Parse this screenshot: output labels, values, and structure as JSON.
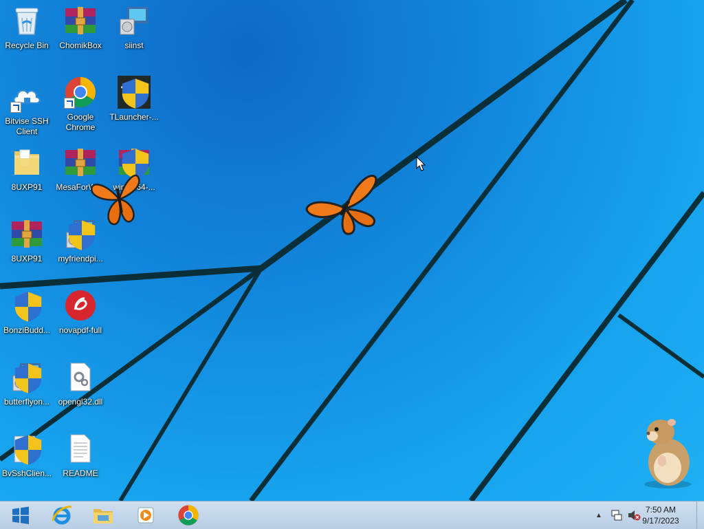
{
  "desktop": {
    "icons": [
      {
        "id": "recycle-bin",
        "label": "Recycle Bin"
      },
      {
        "id": "chomikbox",
        "label": "ChomikBox"
      },
      {
        "id": "siinst",
        "label": "siinst"
      },
      {
        "id": "bitvise",
        "label": "Bitvise SSH Client"
      },
      {
        "id": "chrome",
        "label": "Google Chrome"
      },
      {
        "id": "tlauncher",
        "label": "TLauncher-..."
      },
      {
        "id": "folder-8uxp91",
        "label": "8UXP91"
      },
      {
        "id": "mesaforwin",
        "label": "MesaForWi..."
      },
      {
        "id": "winrar64",
        "label": "win...x64-..."
      },
      {
        "id": "rar-8uxp91",
        "label": "8UXP91"
      },
      {
        "id": "myfriendpi",
        "label": "myfriendpi..."
      },
      {
        "id": "bonzibuddy",
        "label": "BonziBudd..."
      },
      {
        "id": "novapdf",
        "label": "novapdf-full"
      },
      {
        "id": "butterflyon",
        "label": "butterflyon..."
      },
      {
        "id": "opengl32",
        "label": "opengl32.dll"
      },
      {
        "id": "bvsshclient",
        "label": "BvSshClien..."
      },
      {
        "id": "readme",
        "label": "README"
      }
    ]
  },
  "taskbar": {
    "buttons": [
      {
        "id": "start",
        "icon": "windows-logo-icon"
      },
      {
        "id": "ie",
        "icon": "internet-explorer-icon"
      },
      {
        "id": "explorer",
        "icon": "file-explorer-icon"
      },
      {
        "id": "media",
        "icon": "media-player-icon"
      },
      {
        "id": "chrome",
        "icon": "chrome-icon"
      }
    ],
    "tray": {
      "chevron": "▲",
      "time": "7:50 AM",
      "date": "9/17/2023"
    }
  },
  "colors": {
    "accent": "#1287dc",
    "taskbar": "#c4d6ea",
    "wallpaper_lines": "#062a35"
  }
}
